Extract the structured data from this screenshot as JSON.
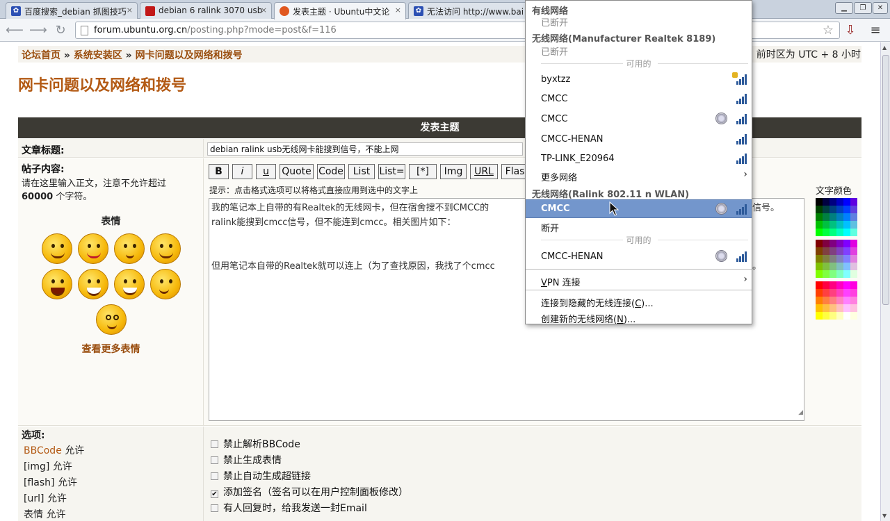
{
  "browser": {
    "tabs": [
      {
        "title": "百度搜索_debian 抓图技巧",
        "icon": "baidu-paw-icon"
      },
      {
        "title": "debian 6 ralink 3070 usb",
        "icon": "red-site-icon"
      },
      {
        "title": "发表主题 · Ubuntu中文论",
        "icon": "ubuntu-icon"
      },
      {
        "title": "无法访问 http://www.bai",
        "icon": "baidu-paw-icon"
      }
    ],
    "close_glyph": "×",
    "window_buttons": {
      "minimize": "▁",
      "restore": "❐",
      "close": "✕"
    },
    "url_host": "forum.ubuntu.org.cn",
    "url_path": "/posting.php?mode=post&f=116"
  },
  "page": {
    "breadcrumb": [
      "论坛首页",
      "系统安装区",
      "网卡问题以及网络和拨号"
    ],
    "breadcrumb_sep": "»",
    "timezone": "前时区为 UTC + 8 小时",
    "forum_title": "网卡问题以及网络和拨号",
    "post_header": "发表主题",
    "subject_label": "文章标题:",
    "subject_value": "debian ralink usb无线网卡能搜到信号，不能上网",
    "body_label": "帖子内容:",
    "body_note_1": "请在这里输入正文，注意不允许超过",
    "body_note_count": "60000",
    "body_note_2": " 个字符。",
    "format_buttons": [
      "B",
      "i",
      "u",
      "Quote",
      "Code",
      "List",
      "List=",
      "[*]",
      "Img",
      "URL",
      "Flash"
    ],
    "hint": "提示：点击格式选项可以将格式直接应用到选中的文字上",
    "editor_lines": [
      "我的笔记本上自带的有Realtek的无线网卡，但在宿舍搜不到CMCC的",
      "ralink能搜到cmcc信号，但不能连到cmcc。相关图片如下：",
      "",
      "",
      "但用笔记本自带的Realtek就可以连上（为了查找原因，我找了个cmcc"
    ],
    "editor_overflow_right_1": "信号。",
    "editor_overflow_right_5": "。",
    "smilies_title": "表情",
    "more_smilies": "查看更多表情",
    "color_label": "文字颜色",
    "options_label": "选项:",
    "permissions": [
      {
        "link": "BBCode",
        "text": " 允许"
      },
      {
        "link": "",
        "text": "[img] 允许"
      },
      {
        "link": "",
        "text": "[flash] 允许"
      },
      {
        "link": "",
        "text": "[url] 允许"
      },
      {
        "link": "",
        "text": "表情 允许"
      }
    ],
    "options": [
      {
        "label": "禁止解析BBCode",
        "checked": false
      },
      {
        "label": "禁止生成表情",
        "checked": false
      },
      {
        "label": "禁止自动生成超链接",
        "checked": false
      },
      {
        "label": "添加签名（签名可以在用户控制面板修改）",
        "checked": true
      },
      {
        "label": "有人回复时，给我发送一封Email",
        "checked": false
      }
    ]
  },
  "network_menu": {
    "wired_header": "有线网络",
    "wired_status": "已断开",
    "wlan1_header": "无线网络(Manufacturer Realtek 8189)",
    "wlan1_status": "已断开",
    "available_label": "可用的",
    "wlan1_networks": [
      {
        "name": "byxtzz",
        "signal": 4,
        "secured": true,
        "adhoc": false
      },
      {
        "name": "CMCC",
        "signal": 4,
        "secured": false,
        "adhoc": false
      },
      {
        "name": "CMCC",
        "signal": 4,
        "secured": false,
        "adhoc": true
      },
      {
        "name": "CMCC-HENAN",
        "signal": 4,
        "secured": false,
        "adhoc": false
      },
      {
        "name": "TP-LINK_E20964",
        "signal": 4,
        "secured": false,
        "adhoc": false
      }
    ],
    "more_networks": "更多网络",
    "wlan2_header": "无线网络(Ralink 802.11 n WLAN)",
    "wlan2_connected": {
      "name": "CMCC",
      "signal": 4,
      "adhoc": true
    },
    "disconnect": "断开",
    "wlan2_networks": [
      {
        "name": "CMCC-HENAN",
        "signal": 4,
        "adhoc": true
      }
    ],
    "vpn": "VPN 连接",
    "vpn_mnemonic": "V",
    "vpn_rest": "PN 连接",
    "connect_hidden": "连接到隐藏的无线连接(",
    "connect_hidden_key": "C",
    "connect_hidden_end": ")...",
    "create_new": "创建新的无线网络(",
    "create_new_key": "N",
    "create_new_end": ")..."
  },
  "colors": {
    "accent_brown": "#b35a14",
    "header_dark": "#3c3a34",
    "menu_highlight": "#7396cc"
  }
}
